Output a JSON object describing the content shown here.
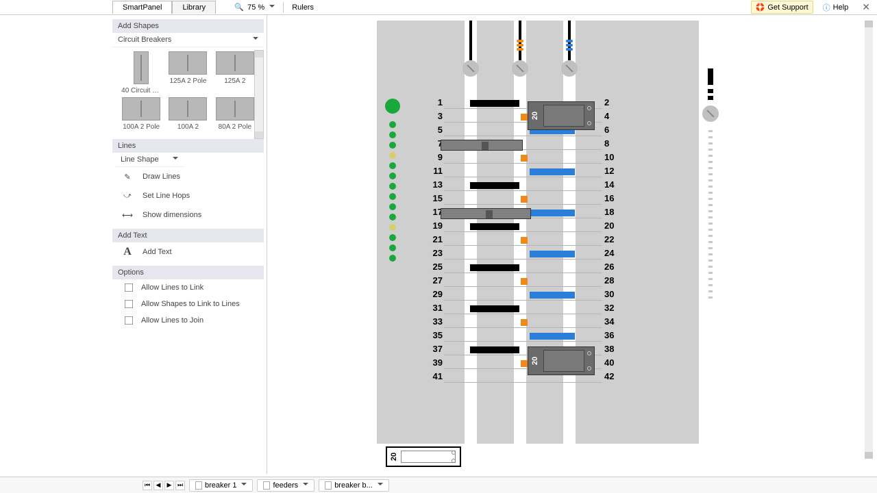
{
  "topbar": {
    "tabs": [
      "SmartPanel",
      "Library"
    ],
    "zoom": "75 %",
    "rulers": "Rulers",
    "support": "Get Support",
    "help": "Help"
  },
  "sidebar": {
    "add_shapes_hdr": "Add Shapes",
    "shapes_category": "Circuit Breakers",
    "shapes": [
      "40 Circuit P...",
      "125A 2 Pole",
      "125A 2",
      "100A 2 Pole",
      "100A 2",
      "80A 2 Pole"
    ],
    "lines_hdr": "Lines",
    "line_shape": "Line Shape",
    "draw_lines": "Draw Lines",
    "set_line_hops": "Set Line Hops",
    "show_dims": "Show dimensions",
    "add_text_hdr": "Add Text",
    "add_text": "Add Text",
    "options_hdr": "Options",
    "opt1": "Allow Lines to Link",
    "opt2": "Allow Shapes to Link to Lines",
    "opt3": "Allow Lines to Join"
  },
  "panel": {
    "breaker_lbl": "20",
    "rows": [
      {
        "l": "1",
        "r": "2",
        "black": true
      },
      {
        "l": "3",
        "r": "4",
        "orange": true
      },
      {
        "l": "5",
        "r": "6",
        "blue": true
      },
      {
        "l": "7",
        "r": "8"
      },
      {
        "l": "9",
        "r": "10",
        "orange": true
      },
      {
        "l": "11",
        "r": "12",
        "blue": true
      },
      {
        "l": "13",
        "r": "14",
        "black": true
      },
      {
        "l": "15",
        "r": "16",
        "orange": true
      },
      {
        "l": "17",
        "r": "18",
        "blue": true
      },
      {
        "l": "19",
        "r": "20",
        "black": true
      },
      {
        "l": "21",
        "r": "22",
        "orange": true
      },
      {
        "l": "23",
        "r": "24",
        "blue": true
      },
      {
        "l": "25",
        "r": "26",
        "black": true
      },
      {
        "l": "27",
        "r": "28",
        "orange": true
      },
      {
        "l": "29",
        "r": "30",
        "blue": true
      },
      {
        "l": "31",
        "r": "32",
        "black": true
      },
      {
        "l": "33",
        "r": "34",
        "orange": true
      },
      {
        "l": "35",
        "r": "36",
        "blue": true
      },
      {
        "l": "37",
        "r": "38",
        "black": true
      },
      {
        "l": "39",
        "r": "40",
        "orange": true
      },
      {
        "l": "41",
        "r": "42"
      }
    ]
  },
  "floating": {
    "lbl": "20"
  },
  "bottombar": {
    "tabs": [
      "breaker 1",
      "feeders",
      "breaker b..."
    ]
  }
}
